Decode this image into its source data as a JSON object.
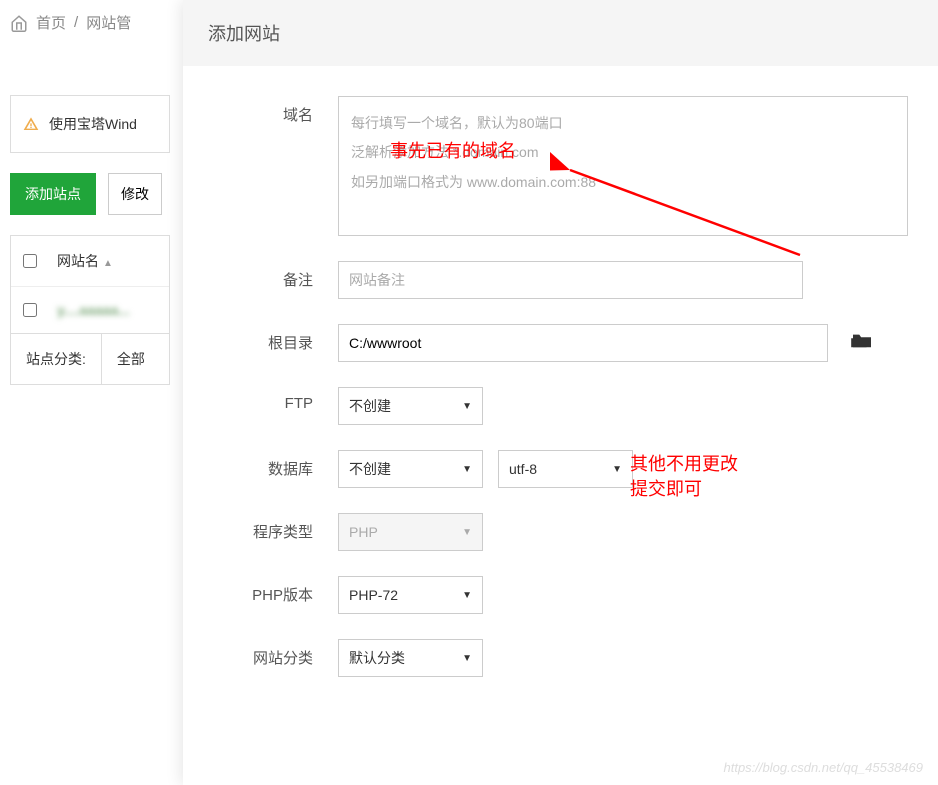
{
  "breadcrumb": {
    "home": "首页",
    "current": "网站管"
  },
  "warning": {
    "text": "使用宝塔Wind"
  },
  "buttons": {
    "add_site": "添加站点",
    "modify": "修改"
  },
  "table": {
    "col_site": "网站名",
    "row1_blur": "y....aaaaa..."
  },
  "filter": {
    "label": "站点分类:",
    "value": "全部"
  },
  "modal": {
    "title": "添加网站",
    "labels": {
      "domain": "域名",
      "note": "备注",
      "rootdir": "根目录",
      "ftp": "FTP",
      "database": "数据库",
      "program_type": "程序类型",
      "php_version": "PHP版本",
      "site_category": "网站分类"
    },
    "placeholders": {
      "domain": "每行填写一个域名，默认为80端口\n泛解析添加方法 *.domain.com\n如另加端口格式为 www.domain.com:88",
      "note": "网站备注"
    },
    "values": {
      "rootdir": "C:/wwwroot",
      "ftp": "不创建",
      "database": "不创建",
      "encoding": "utf-8",
      "program_type": "PHP",
      "php_version": "PHP-72",
      "site_category": "默认分类"
    }
  },
  "annotations": {
    "a1": "事先已有的域名",
    "a2_line1": "其他不用更改",
    "a2_line2": "提交即可"
  },
  "watermark": "https://blog.csdn.net/qq_45538469"
}
